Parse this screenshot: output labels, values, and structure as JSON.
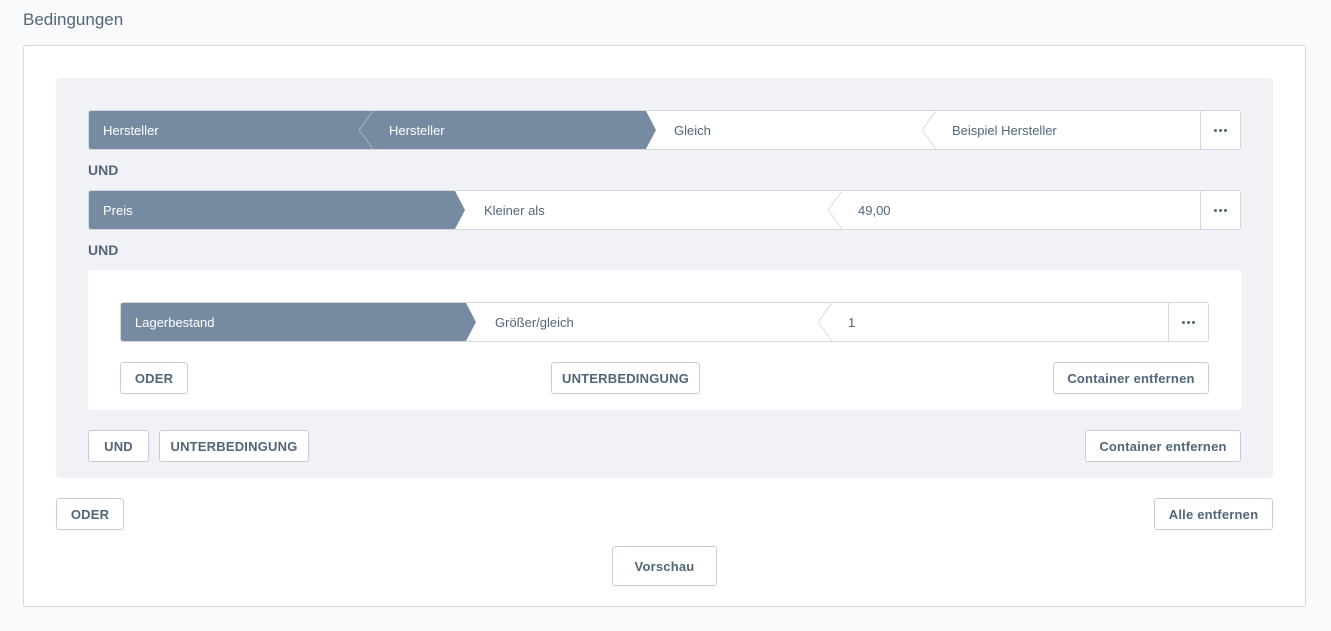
{
  "page": {
    "title": "Bedingungen"
  },
  "colors": {
    "accent": "#768ba1",
    "border": "#d1d9e0",
    "container_bg": "#f0f2f5"
  },
  "conditions": [
    {
      "segments": [
        "Hersteller",
        "Hersteller",
        "Gleich",
        "Beispiel Hersteller"
      ]
    },
    {
      "segments": [
        "Preis",
        "Kleiner als",
        "49,00"
      ]
    }
  ],
  "connectors": [
    "UND",
    "UND"
  ],
  "inner": {
    "condition": {
      "segments": [
        "Lagerbestand",
        "Größer/gleich",
        "1"
      ]
    },
    "buttons": {
      "or": "ODER",
      "sub": "UNTERBEDINGUNG",
      "remove": "Container entfernen"
    }
  },
  "outer_buttons": {
    "and": "UND",
    "sub": "UNTERBEDINGUNG",
    "remove": "Container entfernen"
  },
  "card_buttons": {
    "or": "ODER",
    "remove_all": "Alle entfernen",
    "preview": "Vorschau"
  },
  "icons": {
    "more": "ellipsis-icon"
  }
}
